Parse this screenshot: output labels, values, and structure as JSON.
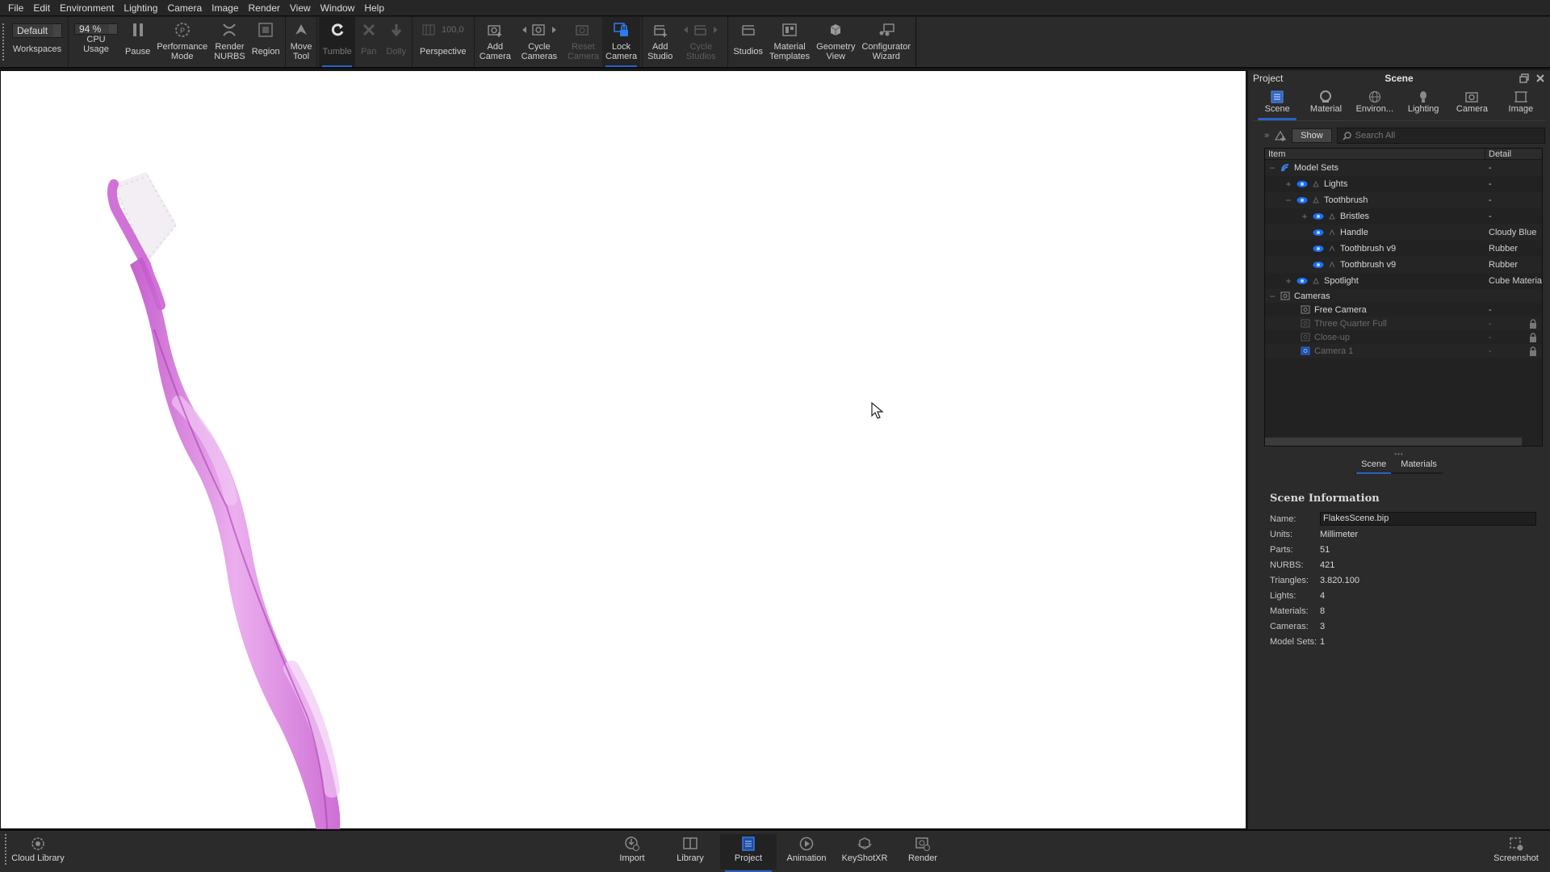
{
  "menubar": {
    "items": [
      "File",
      "Edit",
      "Environment",
      "Lighting",
      "Camera",
      "Image",
      "Render",
      "View",
      "Window",
      "Help"
    ]
  },
  "toolbar": {
    "workspaces": {
      "value": "Default",
      "label": "Workspaces"
    },
    "cpu_usage": {
      "value": "94 %",
      "label": "CPU Usage"
    },
    "pause": "Pause",
    "performance_mode": "Performance\nMode",
    "render_nurbs": "Render\nNURBS",
    "region": "Region",
    "move_tool": "Move\nTool",
    "tumble": "Tumble",
    "pan": "Pan",
    "dolly": "Dolly",
    "perspective": {
      "value": "100,0",
      "label": "Perspective"
    },
    "add_camera": "Add\nCamera",
    "cycle_cameras": "Cycle\nCameras",
    "reset_camera": "Reset\nCamera",
    "lock_camera": "Lock\nCamera",
    "add_studio": "Add\nStudio",
    "cycle_studios": "Cycle\nStudios",
    "studios": "Studios",
    "material_templates": "Material\nTemplates",
    "geometry_view": "Geometry\nView",
    "configurator_wizard": "Configurator\nWizard"
  },
  "panel": {
    "project_label": "Project",
    "title": "Scene",
    "tabs": [
      "Scene",
      "Material",
      "Environ...",
      "Lighting",
      "Camera",
      "Image"
    ],
    "active_tab": "Scene",
    "show_button": "Show",
    "search_placeholder": "Search All",
    "tree": {
      "columns": [
        "Item",
        "Detail"
      ],
      "rows": [
        {
          "label": "Model Sets",
          "detail": "-",
          "expander": "−"
        },
        {
          "label": "Lights",
          "detail": "-",
          "expander": "+"
        },
        {
          "label": "Toothbrush",
          "detail": "-",
          "expander": "−"
        },
        {
          "label": "Bristles",
          "detail": "-",
          "expander": "+"
        },
        {
          "label": "Handle",
          "detail": "Cloudy Blue"
        },
        {
          "label": "Toothbrush v9",
          "detail": "Rubber"
        },
        {
          "label": "Toothbrush v9",
          "detail": "Rubber"
        },
        {
          "label": "Spotlight",
          "detail": "Cube Material",
          "expander": "+"
        },
        {
          "label": "Cameras",
          "detail": "",
          "expander": "−"
        },
        {
          "label": "Free Camera",
          "detail": "-"
        },
        {
          "label": "Three Quarter Full",
          "detail": "-",
          "locked": true
        },
        {
          "label": "Close-up",
          "detail": "-",
          "locked": true
        },
        {
          "label": "Camera 1",
          "detail": "-",
          "locked": true
        }
      ]
    },
    "subtabs": [
      "Scene",
      "Materials"
    ],
    "active_subtab": "Scene",
    "scene_info": {
      "heading": "Scene Information",
      "name_label": "Name:",
      "name_value": "FlakesScene.bip",
      "rows": [
        {
          "key": "Units:",
          "value": "Millimeter"
        },
        {
          "key": "Parts:",
          "value": "51"
        },
        {
          "key": "NURBS:",
          "value": "421"
        },
        {
          "key": "Triangles:",
          "value": "3.820.100"
        },
        {
          "key": "Lights:",
          "value": "4"
        },
        {
          "key": "Materials:",
          "value": "8"
        },
        {
          "key": "Cameras:",
          "value": "3"
        },
        {
          "key": "Model Sets:",
          "value": "1"
        }
      ]
    }
  },
  "bottombar": {
    "cloud_library": "Cloud Library",
    "items": [
      "Import",
      "Library",
      "Project",
      "Animation",
      "KeyShotXR",
      "Render"
    ],
    "active": "Project",
    "screenshot": "Screenshot"
  },
  "colors": {
    "accent": "#2a62c4",
    "toothbrush": "#d46fd8",
    "viewport_bg": "#ffffff",
    "ui_bg": "#2b2b2b"
  }
}
